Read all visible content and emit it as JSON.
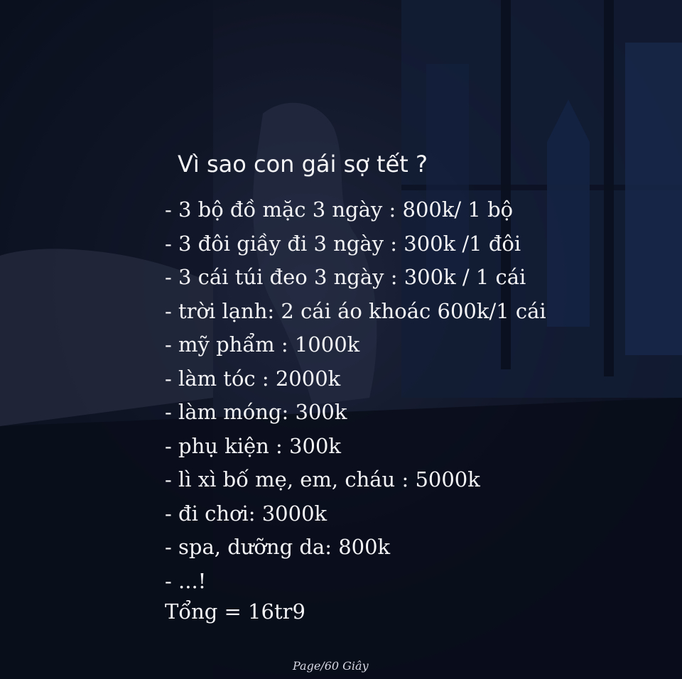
{
  "title": "Vì sao con gái sợ tết ?",
  "items": [
    "- 3 bộ đồ mặc 3 ngày : 800k/ 1 bộ",
    "- 3 đôi giầy đi 3 ngày : 300k /1 đôi",
    "- 3 cái túi đeo 3 ngày : 300k / 1 cái",
    "- trời lạnh: 2 cái áo khoác 600k/1 cái",
    "- mỹ phẩm : 1000k",
    "- làm tóc : 2000k",
    "- làm móng: 300k",
    "- phụ kiện : 300k",
    "- lì xì bố mẹ, em, cháu : 5000k",
    "- đi chơi: 3000k",
    "- spa, dưỡng da: 800k",
    "- ...!"
  ],
  "total": "Tổng = 16tr9",
  "signature": "Page/60 Giây",
  "colors": {
    "background": "#0f1526",
    "text": "#f4f4f6"
  }
}
